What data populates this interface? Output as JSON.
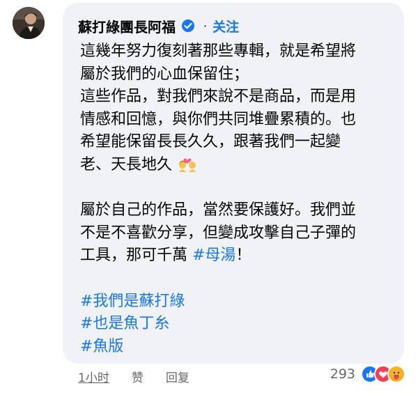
{
  "post": {
    "author_name": "蘇打綠團長阿福",
    "separator": "·",
    "follow_label": "关注",
    "lines": [
      "這幾年努力復刻著那些專輯，就是希望將",
      "屬於我們的心血保留住；",
      "這些作品，對我們來說不是商品，而是用",
      "情感和回憶，與你們共同堆疊累積的。也",
      "希望能保留長長久久，跟著我們一起變",
      "老、天長地久",
      "",
      "屬於自己的作品，當然要保護好。我們並",
      "不是不喜歡分享，但變成攻擊自己子彈的",
      "工具，那可千萬 ",
      "",
      "#我們是蘇打綠",
      "#也是魚丁糸",
      "#魚版"
    ],
    "inline_hashtag": "#母湯",
    "inline_suffix": "！",
    "emoji_couple": "couple-with-heart-emoji"
  },
  "footer": {
    "time": "1小时",
    "like_label": "赞",
    "reply_label": "回复"
  },
  "reactions": {
    "count": "293",
    "icons": [
      "like-reaction-icon",
      "love-reaction-icon",
      "care-reaction-icon"
    ]
  },
  "colors": {
    "bubble": "#f0f2f5",
    "link": "#1877f2",
    "muted": "#65676b"
  }
}
